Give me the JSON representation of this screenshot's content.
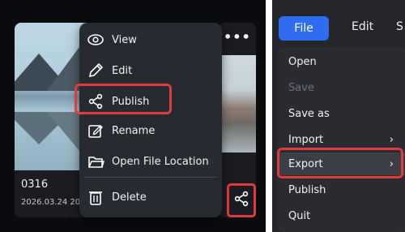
{
  "gallery": {
    "card": {
      "title": "0316",
      "date": "2026.03.24 2026"
    },
    "more_label": "•••",
    "context_menu": {
      "items": [
        {
          "label": "View",
          "icon": "eye-icon"
        },
        {
          "label": "Edit",
          "icon": "pencil-icon"
        },
        {
          "label": "Publish",
          "icon": "share-icon"
        },
        {
          "label": "Rename",
          "icon": "rename-icon"
        },
        {
          "label": "Open File Location",
          "icon": "folder-icon"
        },
        {
          "label": "Delete",
          "icon": "trash-icon"
        }
      ]
    },
    "highlight_color": "#e23b3b"
  },
  "app_menu": {
    "menubar": {
      "file": "File",
      "edit": "Edit",
      "next": "S"
    },
    "file_menu": {
      "items": [
        {
          "label": "Open",
          "disabled": false
        },
        {
          "label": "Save",
          "disabled": true
        },
        {
          "label": "Save as",
          "disabled": false
        },
        {
          "label": "Import",
          "submenu": true
        },
        {
          "label": "Export",
          "submenu": true,
          "selected": true
        },
        {
          "label": "Publish",
          "disabled": false
        },
        {
          "label": "Quit",
          "disabled": false
        }
      ],
      "submenu_glyph": "›"
    },
    "accent": "#2f6cf0"
  }
}
